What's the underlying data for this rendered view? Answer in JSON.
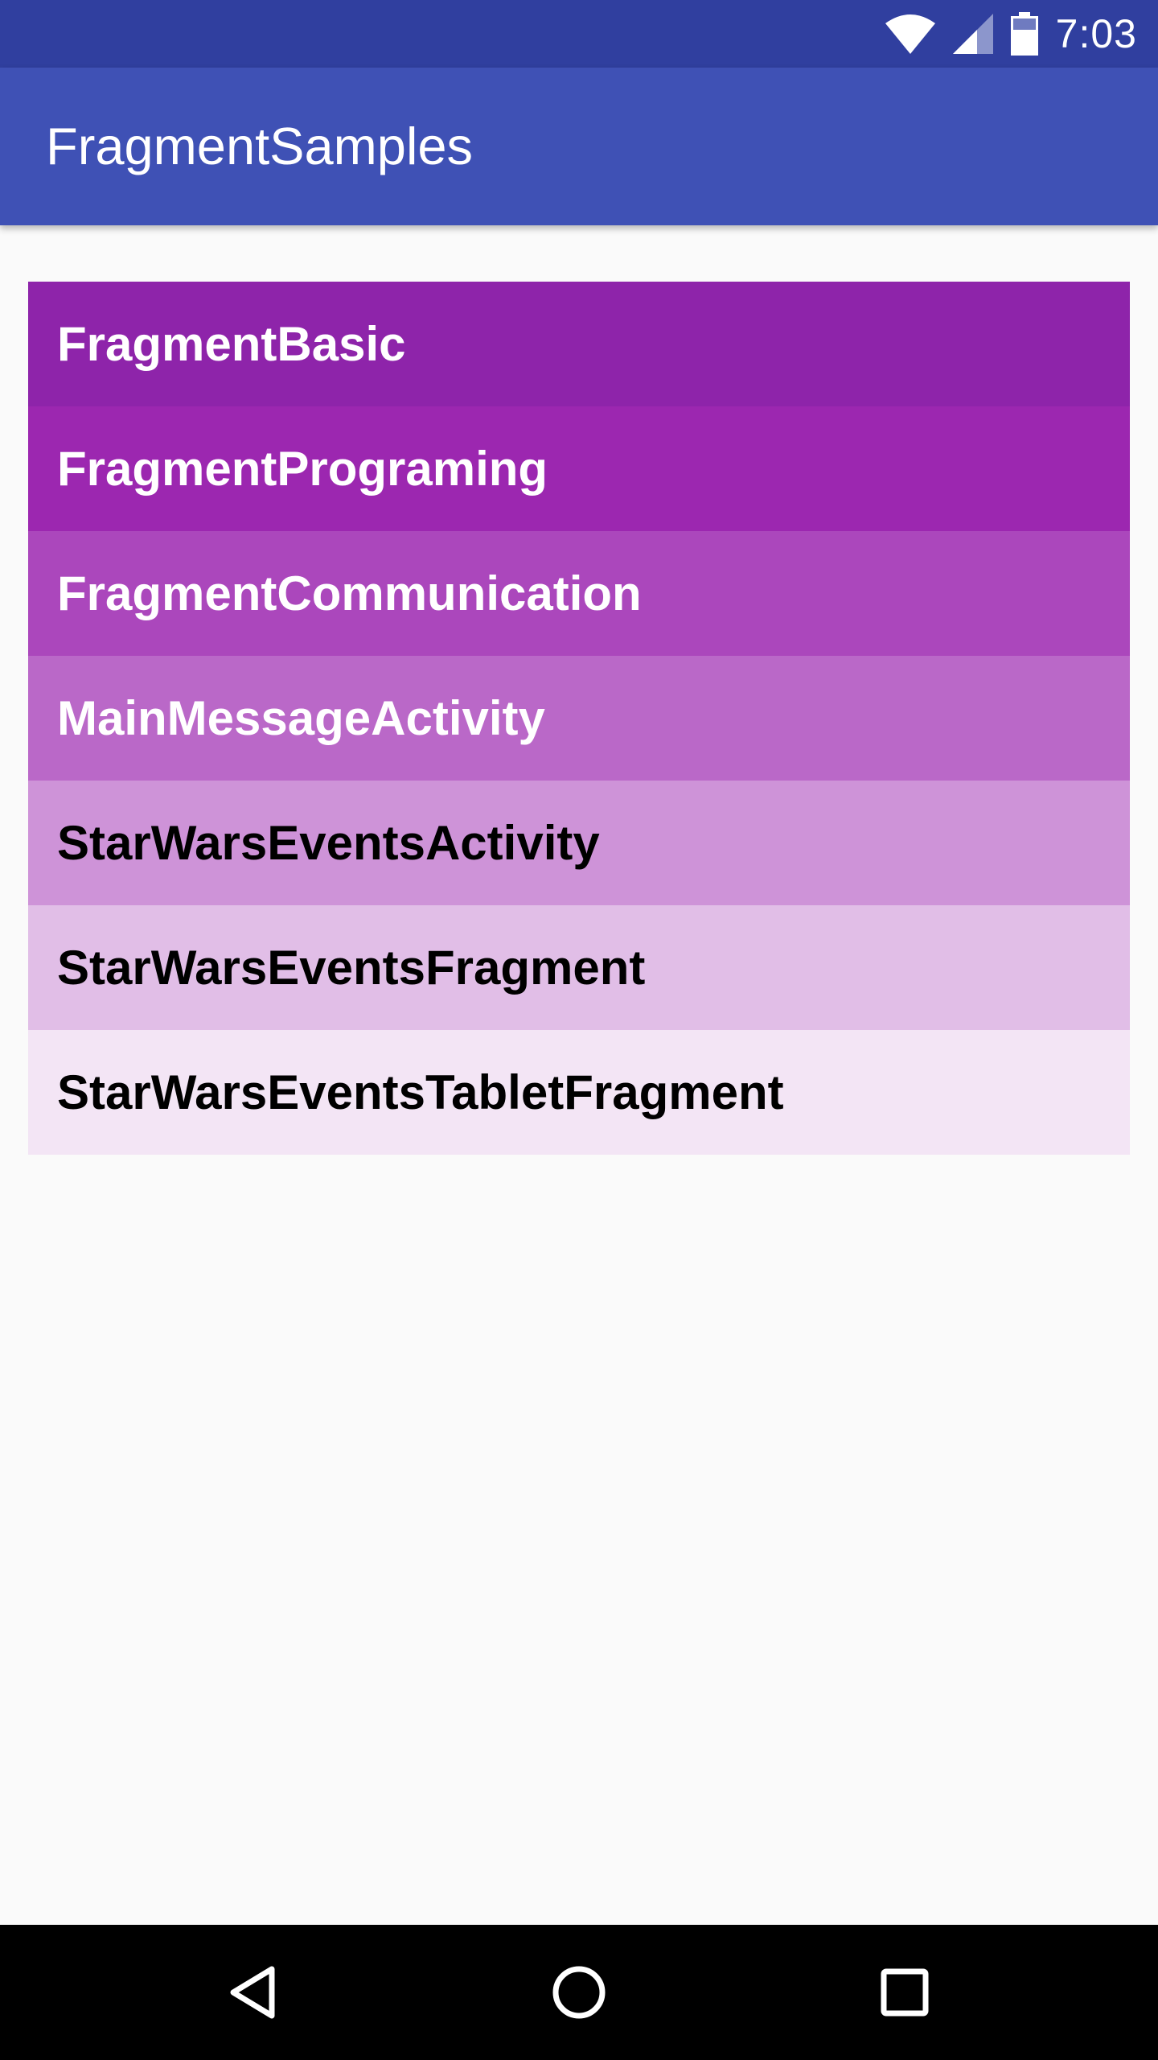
{
  "status_bar": {
    "time": "7:03",
    "icons": [
      "wifi-icon",
      "cell-signal-icon",
      "battery-icon"
    ],
    "color": "#303f9f"
  },
  "app_bar": {
    "title": "FragmentSamples",
    "color": "#3f51b5"
  },
  "list": {
    "items": [
      {
        "label": "FragmentBasic",
        "color": "#8e24aa"
      },
      {
        "label": "FragmentPrograming",
        "color": "#9c27b0"
      },
      {
        "label": "FragmentCommunication",
        "color": "#ab47bc"
      },
      {
        "label": "MainMessageActivity",
        "color": "#ba68c8"
      },
      {
        "label": "StarWarsEventsActivity",
        "color": "#ce93d8"
      },
      {
        "label": "StarWarsEventsFragment",
        "color": "#e1bee7"
      },
      {
        "label": "StarWarsEventsTabletFragment",
        "color": "#f3e5f5"
      }
    ]
  },
  "nav_bar": {
    "buttons": [
      "back-icon",
      "home-icon",
      "recents-icon"
    ]
  }
}
